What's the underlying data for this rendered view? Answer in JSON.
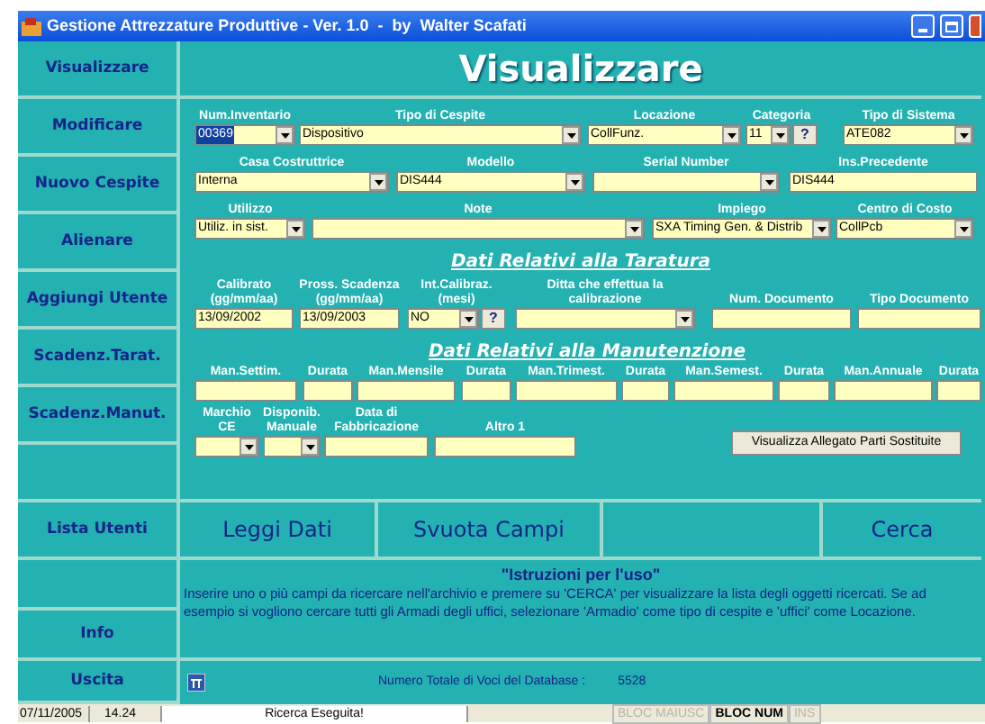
{
  "window": {
    "title": "Gestione Attrezzature Produttive - Ver. 1.0  -  by  Walter Scafati"
  },
  "sidebar": {
    "items": [
      "Visualizzare",
      "Modificare",
      "Nuovo Cespite",
      "Alienare",
      "Aggiungi Utente",
      "Scadenz.Tarat.",
      "Scadenz.Manut.",
      "Lista Utenti",
      "Info",
      "Uscita"
    ]
  },
  "heading": "Visualizzare",
  "form_rows": [
    [
      {
        "label": "Num.Inventario",
        "value": "00369",
        "kind": "combo",
        "selected": true
      },
      {
        "label": "Tipo di Cespite",
        "value": "Dispositivo",
        "kind": "combo"
      },
      {
        "label": "Locazione",
        "value": "CollFunz.",
        "kind": "combo"
      },
      {
        "label": "Categoria",
        "value": "11",
        "kind": "combo",
        "help": "?"
      },
      {
        "label": "Tipo di Sistema",
        "value": "ATE082",
        "kind": "combo"
      }
    ],
    [
      {
        "label": "Casa Costruttrice",
        "value": "Interna",
        "kind": "combo"
      },
      {
        "label": "Modello",
        "value": "DIS444",
        "kind": "combo"
      },
      {
        "label": "Serial Number",
        "kind": "combo"
      },
      {
        "label": "Ins.Precedente",
        "value": "DIS444",
        "kind": "text"
      }
    ],
    [
      {
        "label": "Utilizzo",
        "value": "Utiliz. in sist.",
        "kind": "combo"
      },
      {
        "label": "Note",
        "kind": "combo"
      },
      {
        "label": "Impiego",
        "value": "SXA Timing Gen. & Distrib",
        "kind": "combo"
      },
      {
        "label": "Centro di Costo",
        "value": "CollPcb",
        "kind": "combo"
      }
    ]
  ],
  "taratura": {
    "title": "Dati Relativi alla Taratura",
    "fields": [
      {
        "label": "Calibrato (gg/mm/aa)",
        "value": "13/09/2002",
        "kind": "text"
      },
      {
        "label": "Pross. Scadenza (gg/mm/aa)",
        "value": "13/09/2003",
        "kind": "text"
      },
      {
        "label": "Int.Calibraz. (mesi)",
        "value": "NO",
        "kind": "combo",
        "help": "?"
      },
      {
        "label": "Ditta che effettua la calibrazione",
        "kind": "combo"
      },
      {
        "label": "Num. Documento",
        "kind": "text"
      },
      {
        "label": "Tipo Documento",
        "kind": "text"
      }
    ]
  },
  "manutenzione": {
    "title": "Dati Relativi alla Manutenzione",
    "fields": [
      {
        "label": "Man.Settim.",
        "kind": "text"
      },
      {
        "label": "Durata",
        "kind": "text"
      },
      {
        "label": "Man.Mensile",
        "kind": "text"
      },
      {
        "label": "Durata",
        "kind": "text"
      },
      {
        "label": "Man.Trimest.",
        "kind": "text"
      },
      {
        "label": "Durata",
        "kind": "text"
      },
      {
        "label": "Man.Semest.",
        "kind": "text"
      },
      {
        "label": "Durata",
        "kind": "text"
      },
      {
        "label": "Man.Annuale",
        "kind": "text"
      },
      {
        "label": "Durata",
        "kind": "text"
      }
    ]
  },
  "extra_fields": [
    {
      "label": "Marchio CE",
      "kind": "combo"
    },
    {
      "label": "Disponib. Manuale",
      "kind": "combo"
    },
    {
      "label": "Data di Fabbricazione",
      "kind": "text"
    },
    {
      "label": "Altro 1",
      "kind": "text"
    }
  ],
  "attachments_button": "Visualizza Allegato Parti Sostituite",
  "actions": [
    "Leggi Dati",
    "Svuota Campi",
    "Cerca"
  ],
  "instructions": {
    "title": "\"Istruzioni per l'uso\"",
    "text": "Inserire uno o più campi da ricercare nell'archivio e premere su 'CERCA' per visualizzare la lista degli oggetti ricercati. Se ad esempio si vogliono cercare tutti gli Armadi degli uffici, selezionare 'Armadio' come tipo di cespite e 'uffici' come Locazione."
  },
  "footer": {
    "total_label": "Numero Totale di Voci del Database :",
    "total": "5528"
  },
  "status_bar": {
    "date": "07/11/2005",
    "time": "14.24",
    "message": "Ricerca Eseguita!",
    "indicators": [
      {
        "label": "BLOC MAIUSC",
        "on": false
      },
      {
        "label": "BLOC NUM",
        "on": true
      },
      {
        "label": "INS",
        "on": false
      }
    ]
  }
}
